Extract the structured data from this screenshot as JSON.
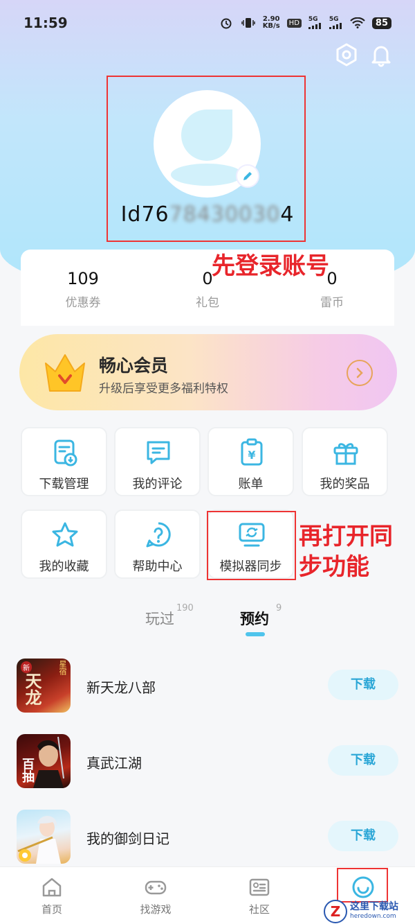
{
  "status_bar": {
    "time": "11:59",
    "net_speed_value": "2.90",
    "net_speed_unit": "KB/s",
    "hd_label": "HD",
    "sim1_label": "5G",
    "sim2_label": "5G",
    "battery": "85"
  },
  "profile": {
    "username_visible_prefix": "Id76",
    "username_blurred": "78430030",
    "username_visible_suffix": "4"
  },
  "annotations": {
    "login_note": "先登录账号",
    "sync_note_line1": "再打开同",
    "sync_note_line2": "步功能"
  },
  "stats": [
    {
      "value": "109",
      "label": "优惠券"
    },
    {
      "value": "0",
      "label": "礼包"
    },
    {
      "value": "0",
      "label": "雷币"
    }
  ],
  "vip": {
    "title": "畅心会员",
    "subtitle": "升级后享受更多福利特权"
  },
  "tiles": [
    {
      "label": "下载管理",
      "icon": "download-manage-icon"
    },
    {
      "label": "我的评论",
      "icon": "comment-icon"
    },
    {
      "label": "账单",
      "icon": "bill-icon"
    },
    {
      "label": "我的奖品",
      "icon": "gift-icon"
    },
    {
      "label": "我的收藏",
      "icon": "star-icon"
    },
    {
      "label": "帮助中心",
      "icon": "help-icon"
    },
    {
      "label": "模拟器同步",
      "icon": "emulator-sync-icon"
    }
  ],
  "tabs": [
    {
      "label": "玩过",
      "count": "190"
    },
    {
      "label": "预约",
      "count": "9"
    }
  ],
  "games": [
    {
      "name": "新天龙八部",
      "button": "下载",
      "icon_text": "天龙",
      "icon_corner": "星宿",
      "icon_side": "新"
    },
    {
      "name": "真武江湖",
      "button": "下载",
      "icon_text": "百抽"
    },
    {
      "name": "我的御剑日记",
      "button": "下载",
      "icon_text": ""
    }
  ],
  "bottom_nav": [
    {
      "label": "首页",
      "icon": "home-icon"
    },
    {
      "label": "找游戏",
      "icon": "gamepad-icon"
    },
    {
      "label": "社区",
      "icon": "community-icon"
    },
    {
      "label": "",
      "icon": "profile-icon"
    }
  ],
  "watermark": {
    "logo_letter": "Z",
    "cn": "这里下载站",
    "en": "heredown.com"
  },
  "colors": {
    "accent": "#4fc4ec",
    "annotation": "#e8252b",
    "vip_orange": "#e7a45a"
  }
}
